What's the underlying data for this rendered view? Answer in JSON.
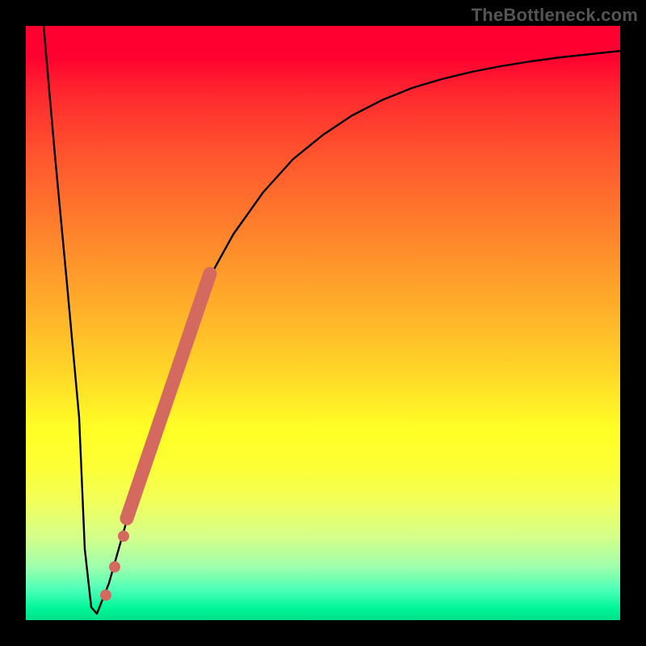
{
  "watermark": {
    "text": "TheBottleneck.com"
  },
  "chart_data": {
    "type": "line",
    "title": "",
    "xlabel": "",
    "ylabel": "",
    "xlim": [
      0,
      100
    ],
    "ylim": [
      0,
      100
    ],
    "grid": false,
    "series": [
      {
        "name": "bottleneck-curve",
        "x": [
          3,
          5,
          7,
          9,
          10,
          11,
          12,
          14,
          18,
          22,
          26,
          30,
          35,
          40,
          45,
          50,
          55,
          60,
          65,
          70,
          75,
          80,
          85,
          90,
          95,
          100
        ],
        "y": [
          100,
          78,
          56,
          34,
          12,
          2,
          1,
          6,
          20,
          34,
          46,
          56,
          65,
          72,
          78,
          82,
          85,
          87.5,
          89.5,
          91,
          92.2,
          93.2,
          94,
          94.7,
          95.3,
          95.8
        ]
      }
    ],
    "markers": [
      {
        "name": "highlight-segment",
        "x": [
          17,
          19,
          21,
          23,
          25,
          27,
          29,
          31
        ],
        "y": [
          17,
          24,
          31,
          37,
          43,
          49,
          54,
          58
        ],
        "color": "#d46a5f",
        "style": "thick-line"
      },
      {
        "name": "near-min-dots",
        "x": [
          13.5,
          15,
          16.5
        ],
        "y": [
          4,
          9,
          14
        ],
        "color": "#d46a5f",
        "style": "dots"
      }
    ],
    "background": {
      "type": "vertical-gradient",
      "stops": [
        {
          "pos": 0.0,
          "color": "#ff0030"
        },
        {
          "pos": 0.68,
          "color": "#ffff26"
        },
        {
          "pos": 1.0,
          "color": "#00e089"
        }
      ]
    }
  }
}
